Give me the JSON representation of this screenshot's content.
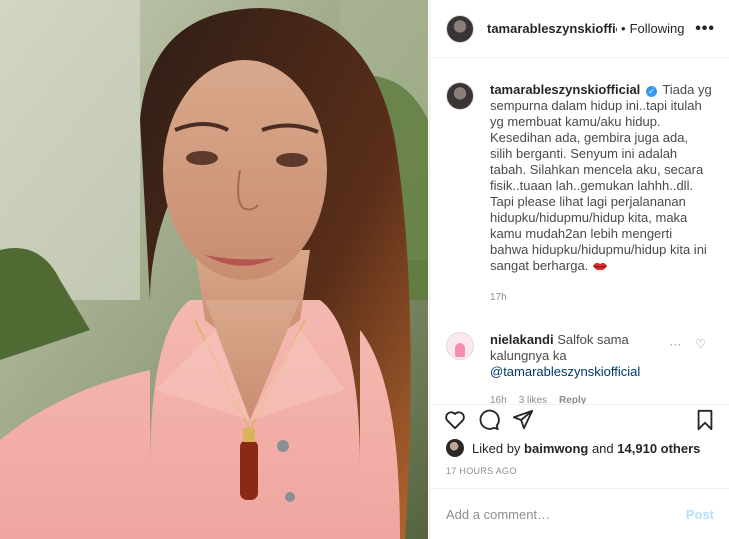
{
  "header": {
    "username": "tamarableszynskiofficial",
    "separator": "•",
    "follow_status": "Following",
    "more_label": "•••"
  },
  "caption": {
    "username": "tamarableszynskiofficial",
    "verified_mark": "✓",
    "text": "Tiada yg sempurna dalam hidup ini..tapi itulah yg membuat kamu/aku hidup. Kesedihan ada, gembira juga ada, silih berganti. Senyum ini adalah tabah. Silahkan mencela aku, secara fisik..tuaan lah..gemukan lahhh..dll. Tapi please lihat lagi perjalananan hidupku/hidupmu/hidup kita, maka kamu mudah2an lebih mengerti bahwa hidupku/hidupmu/hidup kita ini sangat berharga.",
    "time": "17h"
  },
  "comment": {
    "username": "nielakandi",
    "text": "Salfok sama kalungnya ka",
    "mention": "@tamarableszynskiofficial",
    "time": "16h",
    "likes": "3 likes",
    "reply": "Reply",
    "options_icon": "···",
    "heart_icon": "♡"
  },
  "likes": {
    "prefix": "Liked by",
    "user": "baimwong",
    "conj": "and",
    "count": "14,910 others"
  },
  "timestamp": "17 HOURS AGO",
  "add_comment": {
    "placeholder": "Add a comment…",
    "post_label": "Post"
  },
  "colors": {
    "link": "#00376b",
    "post_disabled": "#b2dffc",
    "verified": "#3897f0"
  }
}
